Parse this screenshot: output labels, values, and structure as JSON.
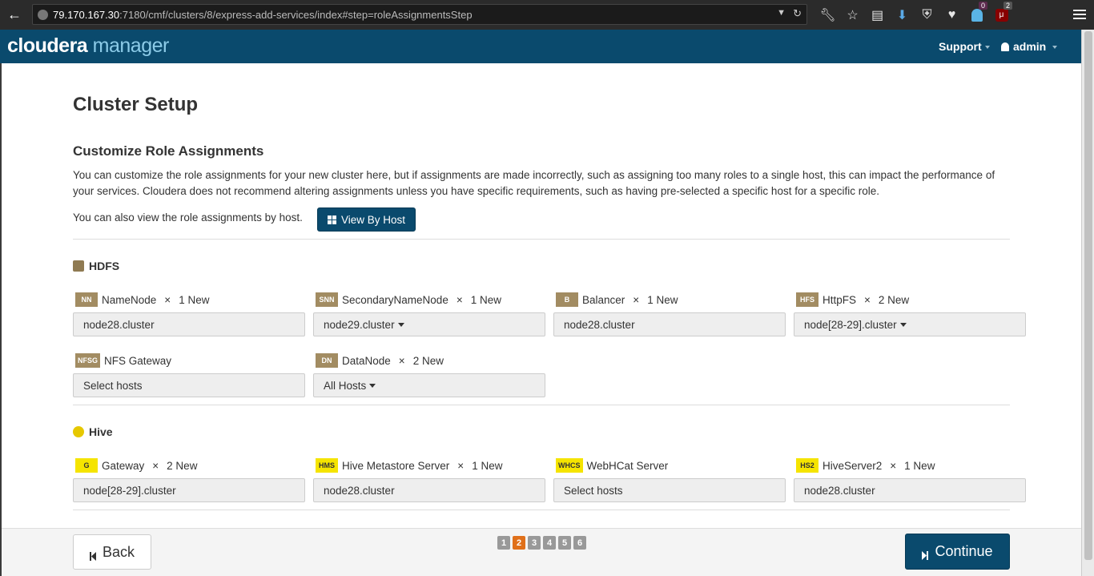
{
  "browser": {
    "url_host": "79.170.167.30",
    "url_rest": ":7180/cmf/clusters/8/express-add-services/index#step=roleAssignmentsStep",
    "ublock_count": "2",
    "ghost_count": "0"
  },
  "header": {
    "logo_main": "cloudera",
    "logo_sub": "manager",
    "support_label": "Support",
    "user_label": "admin"
  },
  "page": {
    "title": "Cluster Setup",
    "section_title": "Customize Role Assignments",
    "description": "You can customize the role assignments for your new cluster here, but if assignments are made incorrectly, such as assigning too many roles to a single host, this can impact the performance of your services. Cloudera does not recommend altering assignments unless you have specific requirements, such as having pre-selected a specific host for a specific role.",
    "view_text": "You can also view the role assignments by host.",
    "view_button": "View By Host"
  },
  "hdfs": {
    "title": "HDFS",
    "roles": [
      {
        "abbr": "NN",
        "name": "NameNode",
        "times": "×",
        "count": "1 New",
        "host": "node28.cluster"
      },
      {
        "abbr": "SNN",
        "name": "SecondaryNameNode",
        "times": "×",
        "count": "1 New",
        "host": "node29.cluster"
      },
      {
        "abbr": "B",
        "name": "Balancer",
        "times": "×",
        "count": "1 New",
        "host": "node28.cluster"
      },
      {
        "abbr": "HFS",
        "name": "HttpFS",
        "times": "×",
        "count": "2 New",
        "host": "node[28-29].cluster"
      },
      {
        "abbr": "NFSG",
        "name": "NFS Gateway",
        "times": "",
        "count": "",
        "host": "Select hosts"
      },
      {
        "abbr": "DN",
        "name": "DataNode",
        "times": "×",
        "count": "2 New",
        "host": "All Hosts"
      }
    ]
  },
  "hive": {
    "title": "Hive",
    "roles": [
      {
        "abbr": "G",
        "name": "Gateway",
        "times": "×",
        "count": "2 New",
        "host": "node[28-29].cluster"
      },
      {
        "abbr": "HMS",
        "name": "Hive Metastore Server",
        "times": "×",
        "count": "1 New",
        "host": "node28.cluster"
      },
      {
        "abbr": "WHCS",
        "name": "WebHCat Server",
        "times": "",
        "count": "",
        "host": "Select hosts"
      },
      {
        "abbr": "HS2",
        "name": "HiveServer2",
        "times": "×",
        "count": "1 New",
        "host": "node28.cluster"
      }
    ]
  },
  "footer": {
    "back_label": "Back",
    "continue_label": "Continue",
    "steps": [
      "1",
      "2",
      "3",
      "4",
      "5",
      "6"
    ],
    "active_step": "2"
  },
  "colors": {
    "brand": "#0a4a6d",
    "hdfs_badge": "#a28c62",
    "hive_badge": "#f5e400",
    "active_step": "#e0701a"
  }
}
